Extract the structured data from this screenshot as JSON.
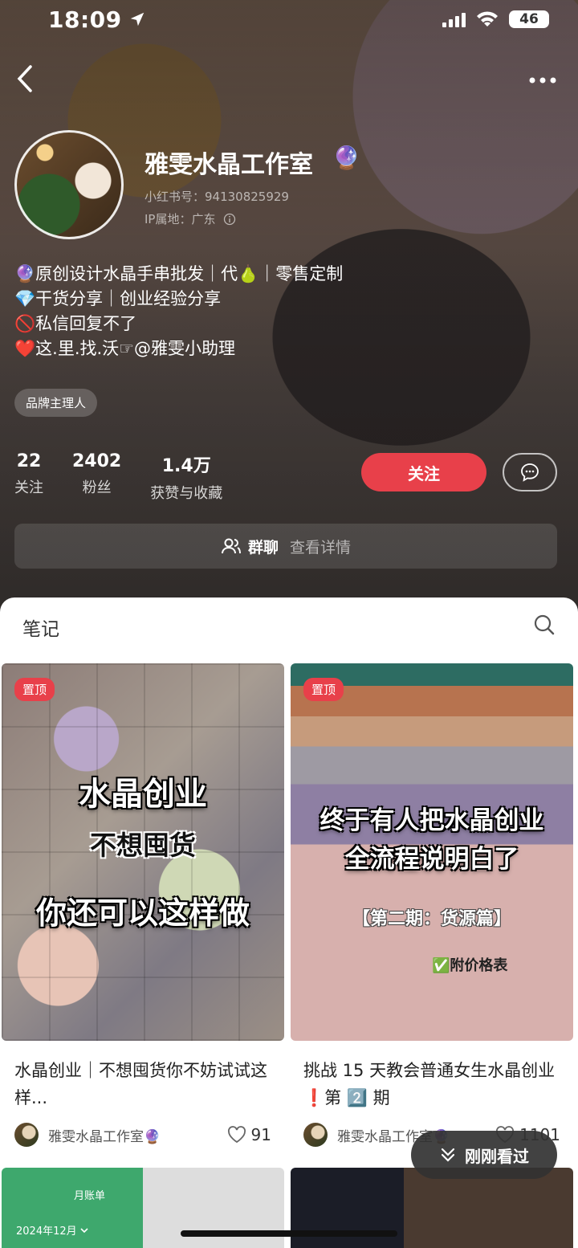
{
  "status": {
    "time": "18:09",
    "battery": "46"
  },
  "profile": {
    "name": "雅雯水晶工作室",
    "red_id": "小红书号：94130825929",
    "ip": "IP属地：广东",
    "bio": [
      "🔮原创设计水晶手串批发｜代🍐｜零售定制",
      "💎干货分享｜创业经验分享",
      "🚫私信回复不了",
      "❤️这.里.找.沃☞@雅雯小助理"
    ],
    "tag": "品牌主理人"
  },
  "stats": [
    {
      "num": "22",
      "label": "关注"
    },
    {
      "num": "2402",
      "label": "粉丝"
    },
    {
      "num": "1.4万",
      "label": "获赞与收藏"
    }
  ],
  "actions": {
    "follow": "关注"
  },
  "group": {
    "title": "群聊",
    "detail": "查看详情"
  },
  "notes": {
    "tab": "笔记",
    "cards": [
      {
        "pin": "置顶",
        "cover_lines": [
          "水晶创业",
          "不想囤货",
          "你还可以这样做"
        ],
        "title": "水晶创业｜不想囤货你不妨试试这样...",
        "author": "雅雯水晶工作室🔮",
        "likes": "91"
      },
      {
        "pin": "置顶",
        "cover_lines": [
          "终于有人把水晶创业",
          "全流程说明白了"
        ],
        "cover_sub": "【第二期：货源篇】",
        "cover_badge": "✅附价格表",
        "title": "挑战 15 天教会普通女生水晶创业❗️第 2️⃣ 期",
        "author": "雅雯水晶工作室🔮",
        "likes": "1101"
      }
    ],
    "row2": {
      "month_tab": "月账单",
      "date": "2024年12月"
    }
  },
  "recent": {
    "label": "刚刚看过"
  },
  "colors": {
    "accent": "#e8404a",
    "sheet": "#ffffff",
    "hero": "#3a3533"
  },
  "icons": [
    "back-icon",
    "more-icon",
    "info-icon",
    "message-icon",
    "group-icon",
    "search-icon",
    "heart-icon",
    "chevron-down-icon"
  ]
}
